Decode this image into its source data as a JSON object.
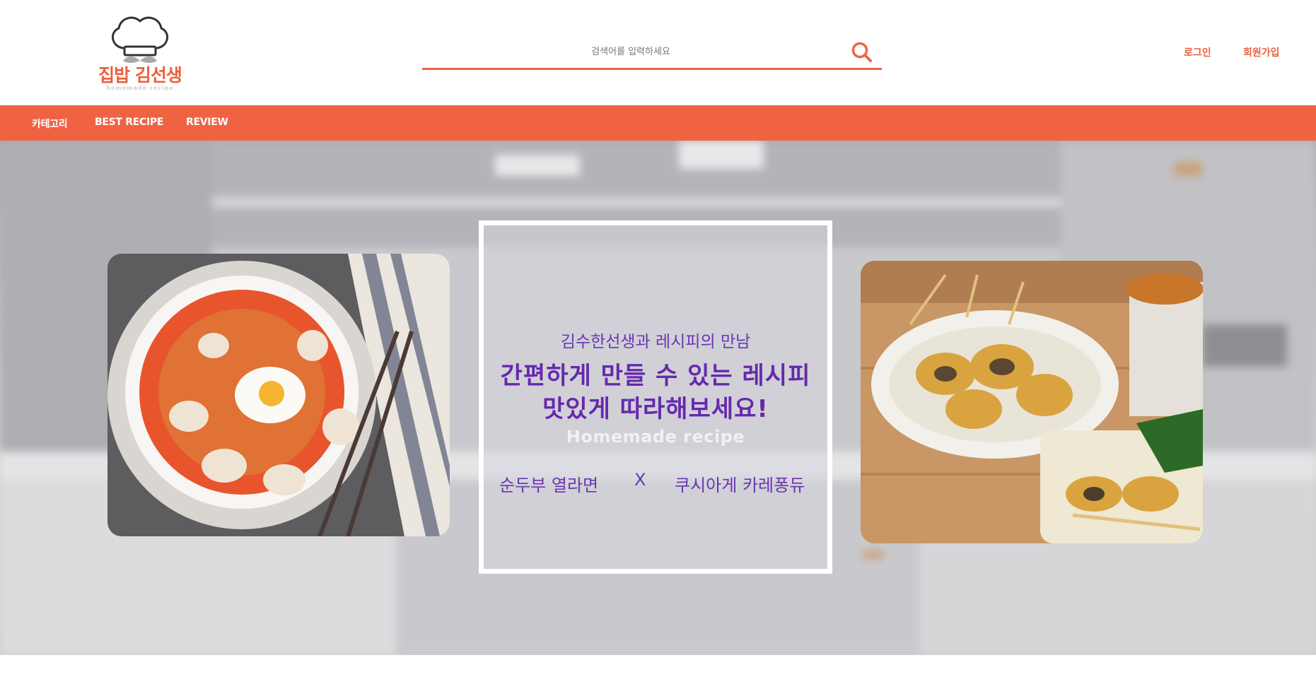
{
  "brand": {
    "title": "집밥 김선생",
    "subtitle": "homemade recipe",
    "color": "#ec5f3e"
  },
  "search": {
    "placeholder": "검색어를 입력하세요",
    "icon": "search-icon"
  },
  "auth": {
    "login": "로그인",
    "signup": "회원가입"
  },
  "nav": {
    "items": [
      "카테고리",
      "BEST RECIPE",
      "REVIEW"
    ],
    "color": "#ef6342"
  },
  "hero": {
    "tagline": "김수한선생과 레시피의 만남",
    "headline_1": "간편하게 만들 수 있는 레시피",
    "headline_2": "맛있게 따라해보세요!",
    "brand_line": "Homemade recipe",
    "dish_left": "순두부 열라면",
    "separator": "X",
    "dish_right": "쿠시아게 카레퐁듀",
    "accent": "#6629ad"
  }
}
